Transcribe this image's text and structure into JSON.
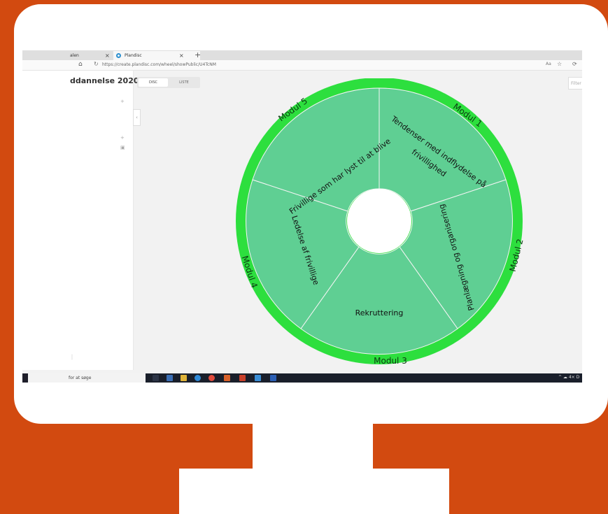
{
  "browser": {
    "tabs": [
      {
        "label": "alen",
        "close": "×"
      },
      {
        "label": "Plandisc",
        "close": "×"
      }
    ],
    "new_tab": "+",
    "url": "https://create.plandisc.com/wheel/showPublic/U4TcNM",
    "reader": "Aa"
  },
  "app": {
    "page_title": "ddannelse 2020 -",
    "view_toggle": {
      "disc": "DISC",
      "list": "LISTE"
    },
    "filter_placeholder": "Filter"
  },
  "wheel": {
    "slices": [
      {
        "label": "Tendenser med indflydelse på frivillighed",
        "label_line1": "Tendenser med indflydelse på",
        "label_line2": "frivillighed"
      },
      {
        "label": "Planlægning og organisering"
      },
      {
        "label": "Rekruttering"
      },
      {
        "label": "Ledelse af frivillige"
      },
      {
        "label": "Frivillige som har lyst til at blive"
      }
    ],
    "modules": [
      "Modul 1",
      "Modul 2",
      "Modul 3",
      "Modul 4",
      "Modul 5"
    ],
    "colors": {
      "ring": "#2ddf3e",
      "slice": "#5fcf93",
      "background": "#d24a10"
    }
  },
  "taskbar": {
    "search_text": "for at søge",
    "tray": "^ ☁ 4× D"
  }
}
